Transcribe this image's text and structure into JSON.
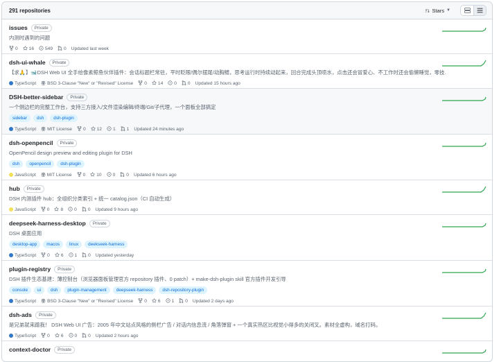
{
  "header": {
    "count": "291 repositories",
    "sort_label": "Stars"
  },
  "colors": {
    "TypeScript": "#3178c6",
    "JavaScript": "#f1e05a",
    "spark": "#2da44e"
  },
  "repos": [
    {
      "name": "issues",
      "visibility": "Private",
      "description": "内测时遇到的问题",
      "topics": [],
      "language": "",
      "license": "",
      "forks": "0",
      "stars": "16",
      "issues": "549",
      "prs": "0",
      "updated": "Updated last week",
      "highlight": false
    },
    {
      "name": "dsh-ui-whale",
      "visibility": "Private",
      "description": "【求🙏】🐋DSH Web UI 全手绘像素鲸鱼伙伴插件：会话标题栏常驻，平时眨眼/偶尔摆尾/动胸鳍，思考运行时持续动起来，回合完成头顶喷水，点击还会冒爱心、不工作时还会偷懒睡觉，零技…",
      "topics": [],
      "language": "TypeScript",
      "license": "BSD 3-Clause \"New\" or \"Revised\" License",
      "forks": "0",
      "stars": "14",
      "issues": "0",
      "prs": "0",
      "updated": "Updated 15 hours ago",
      "highlight": false
    },
    {
      "name": "DSH-better-sidebar",
      "visibility": "Private",
      "description": "一个侧边栏的完整工作台，支持三方接入/文件渲染编辑/终端/Git/子代理，一个面板全部搞定",
      "topics": [
        "sidebar",
        "dsh",
        "dsh-plugin"
      ],
      "language": "TypeScript",
      "license": "MIT License",
      "forks": "0",
      "stars": "12",
      "issues": "1",
      "prs": "1",
      "updated": "Updated 24 minutes ago",
      "highlight": true
    },
    {
      "name": "dsh-openpencil",
      "visibility": "Private",
      "description": "OpenPencil design preview and editing plugin for DSH",
      "topics": [
        "dsh",
        "openpencil",
        "dsh-plugin"
      ],
      "language": "JavaScript",
      "license": "MIT License",
      "forks": "0",
      "stars": "10",
      "issues": "0",
      "prs": "0",
      "updated": "Updated 6 hours ago",
      "highlight": false
    },
    {
      "name": "hub",
      "visibility": "Private",
      "description": "DSH 内测插件 hub：全组织分类索引 + 统一 catalog.json（CI 自动生成）",
      "topics": [],
      "language": "JavaScript",
      "license": "",
      "forks": "0",
      "stars": "8",
      "issues": "0",
      "prs": "0",
      "updated": "Updated 9 hours ago",
      "highlight": false
    },
    {
      "name": "deepseek-harness-desktop",
      "visibility": "Private",
      "description": "DSH 桌面应用",
      "topics": [
        "desktop-app",
        "macos",
        "linux",
        "deekseek-harness"
      ],
      "language": "TypeScript",
      "license": "",
      "forks": "0",
      "stars": "6",
      "issues": "1",
      "prs": "0",
      "updated": "Updated yesterday",
      "highlight": false
    },
    {
      "name": "plugin-registry",
      "visibility": "Private",
      "description": "DSH 插件生态基建：薄控制台（浏览器面板管理官方 repository 插件、0 patch）+ make-dsh-plugin skill 官方插件开发引导",
      "topics": [
        "console",
        "ui",
        "dsh",
        "plugin-management",
        "deepseek-harness",
        "dsh-repository-plugin"
      ],
      "language": "TypeScript",
      "license": "BSD 3-Clause \"New\" or \"Revised\" License",
      "forks": "0",
      "stars": "6",
      "issues": "1",
      "prs": "0",
      "updated": "Updated 2 days ago",
      "highlight": false
    },
    {
      "name": "dsh-ads",
      "visibility": "Private",
      "description": "是兄弟就来蹭我！ DSH Web UI 广告：2005 年中文站点风格的侧栏广告 / 对话内信息流 / 角落弹窗 + 一个真实热区比视觉小得多的关闭叉。素材全虚构，域名打码。",
      "topics": [],
      "language": "TypeScript",
      "license": "",
      "forks": "0",
      "stars": "6",
      "issues": "0",
      "prs": "0",
      "updated": "Updated 2 hours ago",
      "highlight": false
    },
    {
      "name": "context-doctor",
      "visibility": "Private",
      "description": "",
      "topics": [],
      "language": "",
      "license": "",
      "forks": "",
      "stars": "",
      "issues": "",
      "prs": "",
      "updated": "",
      "highlight": false
    }
  ]
}
